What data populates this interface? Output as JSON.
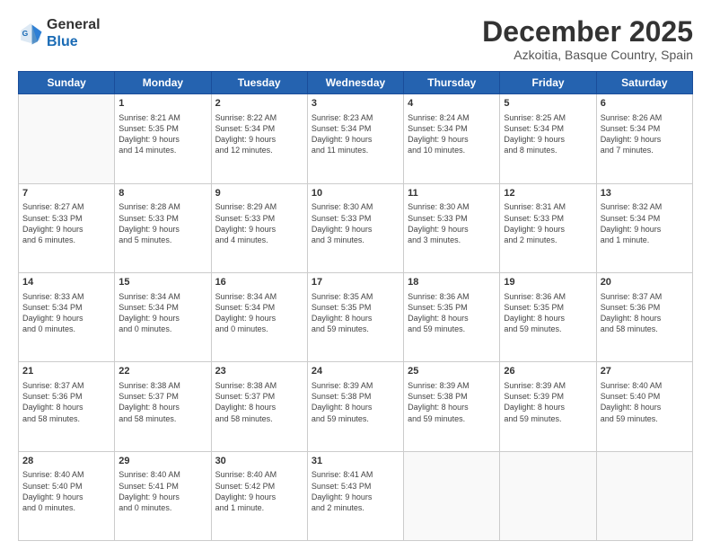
{
  "header": {
    "logo_line1": "General",
    "logo_line2": "Blue",
    "month": "December 2025",
    "location": "Azkoitia, Basque Country, Spain"
  },
  "weekdays": [
    "Sunday",
    "Monday",
    "Tuesday",
    "Wednesday",
    "Thursday",
    "Friday",
    "Saturday"
  ],
  "weeks": [
    [
      {
        "day": "",
        "content": ""
      },
      {
        "day": "1",
        "content": "Sunrise: 8:21 AM\nSunset: 5:35 PM\nDaylight: 9 hours\nand 14 minutes."
      },
      {
        "day": "2",
        "content": "Sunrise: 8:22 AM\nSunset: 5:34 PM\nDaylight: 9 hours\nand 12 minutes."
      },
      {
        "day": "3",
        "content": "Sunrise: 8:23 AM\nSunset: 5:34 PM\nDaylight: 9 hours\nand 11 minutes."
      },
      {
        "day": "4",
        "content": "Sunrise: 8:24 AM\nSunset: 5:34 PM\nDaylight: 9 hours\nand 10 minutes."
      },
      {
        "day": "5",
        "content": "Sunrise: 8:25 AM\nSunset: 5:34 PM\nDaylight: 9 hours\nand 8 minutes."
      },
      {
        "day": "6",
        "content": "Sunrise: 8:26 AM\nSunset: 5:34 PM\nDaylight: 9 hours\nand 7 minutes."
      }
    ],
    [
      {
        "day": "7",
        "content": "Sunrise: 8:27 AM\nSunset: 5:33 PM\nDaylight: 9 hours\nand 6 minutes."
      },
      {
        "day": "8",
        "content": "Sunrise: 8:28 AM\nSunset: 5:33 PM\nDaylight: 9 hours\nand 5 minutes."
      },
      {
        "day": "9",
        "content": "Sunrise: 8:29 AM\nSunset: 5:33 PM\nDaylight: 9 hours\nand 4 minutes."
      },
      {
        "day": "10",
        "content": "Sunrise: 8:30 AM\nSunset: 5:33 PM\nDaylight: 9 hours\nand 3 minutes."
      },
      {
        "day": "11",
        "content": "Sunrise: 8:30 AM\nSunset: 5:33 PM\nDaylight: 9 hours\nand 3 minutes."
      },
      {
        "day": "12",
        "content": "Sunrise: 8:31 AM\nSunset: 5:33 PM\nDaylight: 9 hours\nand 2 minutes."
      },
      {
        "day": "13",
        "content": "Sunrise: 8:32 AM\nSunset: 5:34 PM\nDaylight: 9 hours\nand 1 minute."
      }
    ],
    [
      {
        "day": "14",
        "content": "Sunrise: 8:33 AM\nSunset: 5:34 PM\nDaylight: 9 hours\nand 0 minutes."
      },
      {
        "day": "15",
        "content": "Sunrise: 8:34 AM\nSunset: 5:34 PM\nDaylight: 9 hours\nand 0 minutes."
      },
      {
        "day": "16",
        "content": "Sunrise: 8:34 AM\nSunset: 5:34 PM\nDaylight: 9 hours\nand 0 minutes."
      },
      {
        "day": "17",
        "content": "Sunrise: 8:35 AM\nSunset: 5:35 PM\nDaylight: 8 hours\nand 59 minutes."
      },
      {
        "day": "18",
        "content": "Sunrise: 8:36 AM\nSunset: 5:35 PM\nDaylight: 8 hours\nand 59 minutes."
      },
      {
        "day": "19",
        "content": "Sunrise: 8:36 AM\nSunset: 5:35 PM\nDaylight: 8 hours\nand 59 minutes."
      },
      {
        "day": "20",
        "content": "Sunrise: 8:37 AM\nSunset: 5:36 PM\nDaylight: 8 hours\nand 58 minutes."
      }
    ],
    [
      {
        "day": "21",
        "content": "Sunrise: 8:37 AM\nSunset: 5:36 PM\nDaylight: 8 hours\nand 58 minutes."
      },
      {
        "day": "22",
        "content": "Sunrise: 8:38 AM\nSunset: 5:37 PM\nDaylight: 8 hours\nand 58 minutes."
      },
      {
        "day": "23",
        "content": "Sunrise: 8:38 AM\nSunset: 5:37 PM\nDaylight: 8 hours\nand 58 minutes."
      },
      {
        "day": "24",
        "content": "Sunrise: 8:39 AM\nSunset: 5:38 PM\nDaylight: 8 hours\nand 59 minutes."
      },
      {
        "day": "25",
        "content": "Sunrise: 8:39 AM\nSunset: 5:38 PM\nDaylight: 8 hours\nand 59 minutes."
      },
      {
        "day": "26",
        "content": "Sunrise: 8:39 AM\nSunset: 5:39 PM\nDaylight: 8 hours\nand 59 minutes."
      },
      {
        "day": "27",
        "content": "Sunrise: 8:40 AM\nSunset: 5:40 PM\nDaylight: 8 hours\nand 59 minutes."
      }
    ],
    [
      {
        "day": "28",
        "content": "Sunrise: 8:40 AM\nSunset: 5:40 PM\nDaylight: 9 hours\nand 0 minutes."
      },
      {
        "day": "29",
        "content": "Sunrise: 8:40 AM\nSunset: 5:41 PM\nDaylight: 9 hours\nand 0 minutes."
      },
      {
        "day": "30",
        "content": "Sunrise: 8:40 AM\nSunset: 5:42 PM\nDaylight: 9 hours\nand 1 minute."
      },
      {
        "day": "31",
        "content": "Sunrise: 8:41 AM\nSunset: 5:43 PM\nDaylight: 9 hours\nand 2 minutes."
      },
      {
        "day": "",
        "content": ""
      },
      {
        "day": "",
        "content": ""
      },
      {
        "day": "",
        "content": ""
      }
    ]
  ]
}
